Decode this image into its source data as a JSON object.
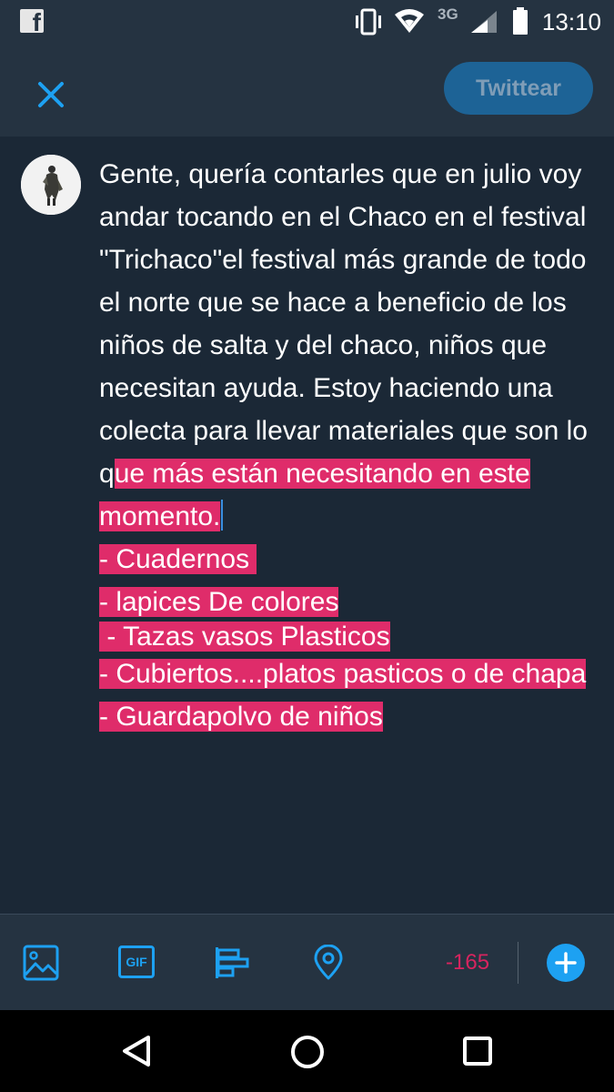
{
  "status_bar": {
    "time": "13:10",
    "network": "3G",
    "notification_icon": "facebook-icon"
  },
  "header": {
    "close_icon": "close-icon",
    "tweet_button_label": "Twittear"
  },
  "compose": {
    "normal_text": "Gente, quería contarles que en julio voy andar tocando en el Chaco en el festival \"Trichaco\"el festival más grande de todo el norte que se hace a beneficio de los niños de salta y del chaco, niños que necesitan ayuda. Estoy haciendo una colecta para llevar materiales que son lo q",
    "highlighted_lead": "ue más están necesitando en este momento.",
    "highlighted_lines": [
      "- Cuadernos ",
      "- lapices De colores",
      " - Tazas vasos Plasticos",
      "- Cubiertos....platos pasticos o de chapa",
      "- Guardapolvo de niños"
    ],
    "highlight_color": "#df2c6a"
  },
  "toolbar": {
    "icons": [
      "image-icon",
      "gif-icon",
      "poll-icon",
      "location-icon",
      "add-icon"
    ],
    "gif_label": "GIF",
    "char_count": "-165",
    "accent_color": "#1da1f2",
    "count_color": "#d8245f"
  },
  "colors": {
    "background": "#1b2836",
    "bar_background": "#253341"
  }
}
